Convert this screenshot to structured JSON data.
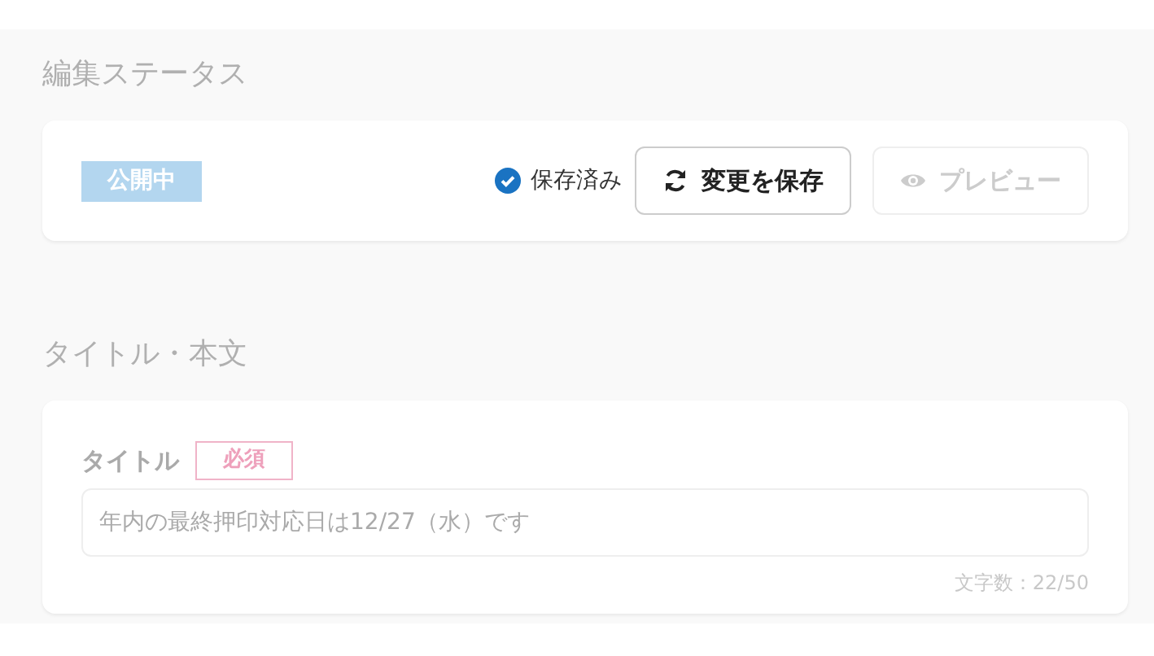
{
  "sections": [
    {
      "kind": "status",
      "heading": "編集ステータス",
      "status_badge": "公開中",
      "saved": {
        "label": "保存済み",
        "checked": true
      },
      "buttons": [
        {
          "kind": "save",
          "label": "変更を保存",
          "disabled": false
        },
        {
          "kind": "preview",
          "label": "プレビュー",
          "disabled": true
        }
      ]
    },
    {
      "kind": "fields",
      "heading": "タイトル・本文",
      "fields": [
        {
          "label": "タイトル",
          "required_badge": "必須",
          "value": "年内の最終押印対応日は12/27（水）です",
          "counter": "文字数：22/50"
        }
      ]
    }
  ]
}
